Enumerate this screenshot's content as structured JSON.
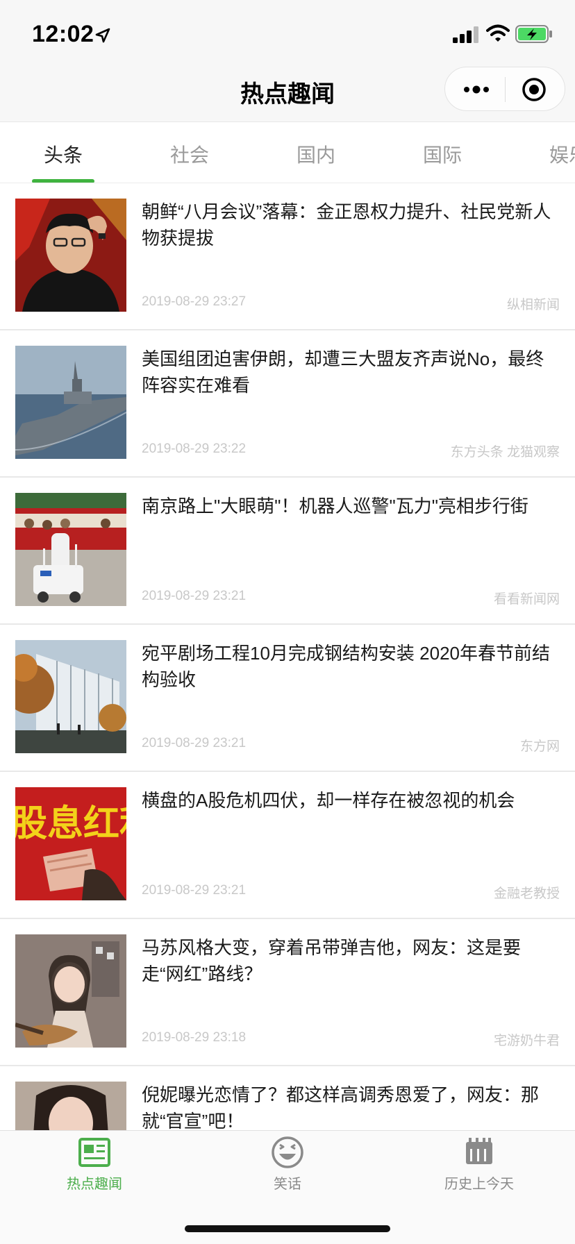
{
  "status_bar": {
    "time": "12:02"
  },
  "nav": {
    "title": "热点趣闻"
  },
  "tabs": [
    {
      "label": "头条",
      "active": true
    },
    {
      "label": "社会",
      "active": false
    },
    {
      "label": "国内",
      "active": false
    },
    {
      "label": "国际",
      "active": false
    },
    {
      "label": "娱乐",
      "active": false
    }
  ],
  "news": [
    {
      "title": "朝鲜“八月会议”落幕：金正恩权力提升、社民党新人物获提拔",
      "time": "2019-08-29 23:27",
      "source": "纵相新闻",
      "thumb": "portrait-photo"
    },
    {
      "title": "美国组团迫害伊朗，却遭三大盟友齐声说No，最终阵容实在难看",
      "time": "2019-08-29 23:22",
      "source": "东方头条 龙猫观察",
      "thumb": "warship-photo"
    },
    {
      "title": "南京路上\"大眼萌\"！机器人巡警\"瓦力\"亮相步行街",
      "time": "2019-08-29 23:21",
      "source": "看看新闻网",
      "thumb": "robot-photo"
    },
    {
      "title": "宛平剧场工程10月完成钢结构安装 2020年春节前结构验收",
      "time": "2019-08-29 23:21",
      "source": "东方网",
      "thumb": "building-photo"
    },
    {
      "title": "横盘的A股危机四伏，却一样存在被忽视的机会",
      "time": "2019-08-29 23:21",
      "source": "金融老教授",
      "thumb": "dividend-photo",
      "thumb_text": "股息红利"
    },
    {
      "title": "马苏风格大变，穿着吊带弹吉他，网友：这是要走“网红”路线？",
      "time": "2019-08-29 23:18",
      "source": "宅游奶牛君",
      "thumb": "guitar-photo"
    },
    {
      "title": "倪妮曝光恋情了？都这样高调秀恩爱了，网友：那就“官宣”吧！",
      "time": "",
      "source": "",
      "thumb": "woman-photo"
    }
  ],
  "tab_bar": [
    {
      "label": "热点趣闻",
      "icon": "news-icon",
      "active": true
    },
    {
      "label": "笑话",
      "icon": "laugh-icon",
      "active": false
    },
    {
      "label": "历史上今天",
      "icon": "calendar-icon",
      "active": false
    }
  ],
  "colors": {
    "accent_green": "#3fb33f",
    "meta_gray": "#c8c8c8"
  }
}
